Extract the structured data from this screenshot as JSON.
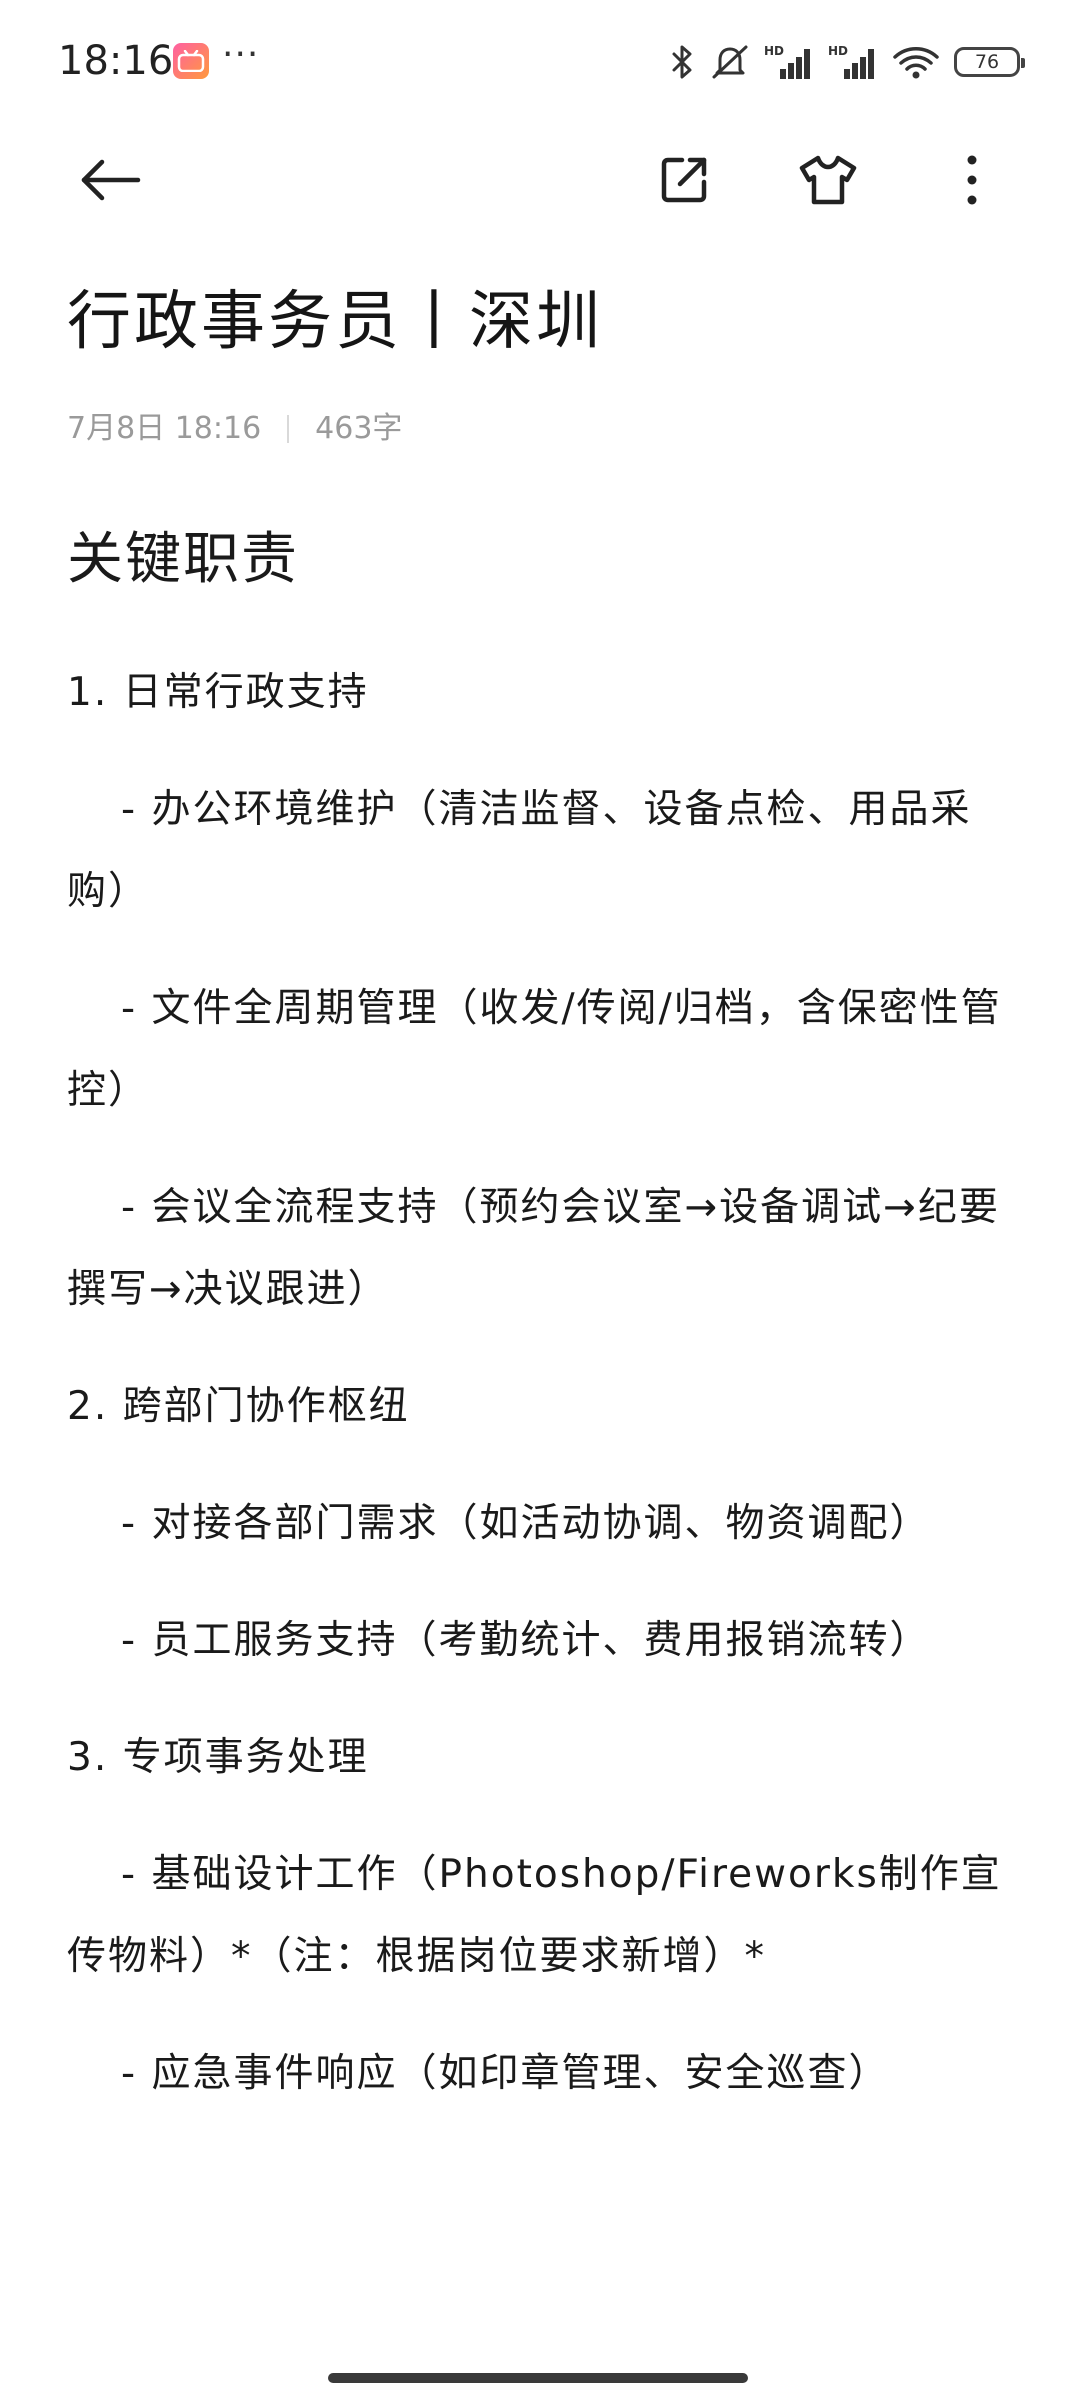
{
  "status_bar": {
    "time": "18:16",
    "app_badge": "bilibili",
    "more": "···",
    "battery": "76",
    "network_labels": [
      "HD",
      "HD"
    ]
  },
  "toolbar": {
    "back_icon": "arrow-left-icon",
    "share_icon": "share-icon",
    "theme_icon": "shirt-icon",
    "menu_icon": "more-vertical-icon"
  },
  "note": {
    "title": "行政事务员丨深圳",
    "date": "7月8日  18:16",
    "word_count": "463字",
    "section_heading": "关键职责",
    "lines": [
      {
        "text": "1. 日常行政支持",
        "sub": false
      },
      {
        "text": "- 办公环境维护（清洁监督、设备点检、用品采购）",
        "sub": true
      },
      {
        "text": "- 文件全周期管理（收发/传阅/归档，含保密性管控）",
        "sub": true
      },
      {
        "text": "- 会议全流程支持（预约会议室→设备调试→纪要撰写→决议跟进）",
        "sub": true
      },
      {
        "text": "2. 跨部门协作枢纽",
        "sub": false
      },
      {
        "text": "- 对接各部门需求（如活动协调、物资调配）",
        "sub": true
      },
      {
        "text": "- 员工服务支持（考勤统计、费用报销流转）",
        "sub": true
      },
      {
        "text": "3. 专项事务处理",
        "sub": false
      },
      {
        "text": "- 基础设计工作（Photoshop/Fireworks制作宣传物料）*（注：根据岗位要求新增）*",
        "sub": true
      },
      {
        "text": "- 应急事件响应（如印章管理、安全巡查）",
        "sub": true
      }
    ]
  }
}
